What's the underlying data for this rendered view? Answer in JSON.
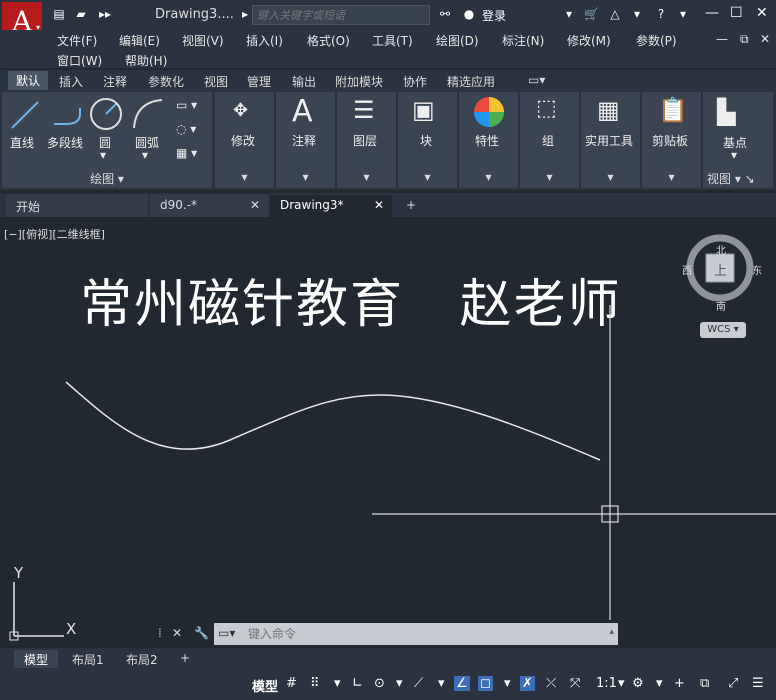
{
  "app": {
    "document_title": "Drawing3....",
    "search_placeholder": "键入关键字或短语",
    "login_label": "登录"
  },
  "menu": [
    "文件(F)",
    "编辑(E)",
    "视图(V)",
    "插入(I)",
    "格式(O)",
    "工具(T)",
    "绘图(D)",
    "标注(N)",
    "修改(M)",
    "参数(P)",
    "窗口(W)",
    "帮助(H)"
  ],
  "ribbon_tabs": [
    "默认",
    "插入",
    "注释",
    "参数化",
    "视图",
    "管理",
    "输出",
    "附加模块",
    "协作",
    "精选应用"
  ],
  "ribbon": {
    "draw": {
      "line": "直线",
      "polyline": "多段线",
      "circle": "圆",
      "arc": "圆弧",
      "panel_title": "绘图"
    },
    "modify": "修改",
    "annotate": "注释",
    "layers": "图层",
    "block": "块",
    "properties": "特性",
    "group": "组",
    "utilities": "实用工具",
    "clipboard": "剪贴板",
    "basepoint": "基点",
    "view": "视图"
  },
  "doc_tabs": [
    {
      "label": "开始",
      "closable": false
    },
    {
      "label": "d90.-*",
      "closable": true
    },
    {
      "label": "Drawing3*",
      "closable": true,
      "active": true
    }
  ],
  "canvas": {
    "view_label": "[−][俯视][二维线框]",
    "overlay_text": "常州磁针教育   赵老师",
    "viewcube": {
      "north": "北",
      "south": "南",
      "east": "东",
      "west": "西",
      "top": "上"
    },
    "wcs": "WCS",
    "ucs_y": "Y",
    "ucs_x": "X"
  },
  "command": {
    "placeholder": "键入命令"
  },
  "layout_tabs": [
    "模型",
    "布局1",
    "布局2"
  ],
  "status": {
    "model": "模型",
    "scale": "1:1"
  }
}
